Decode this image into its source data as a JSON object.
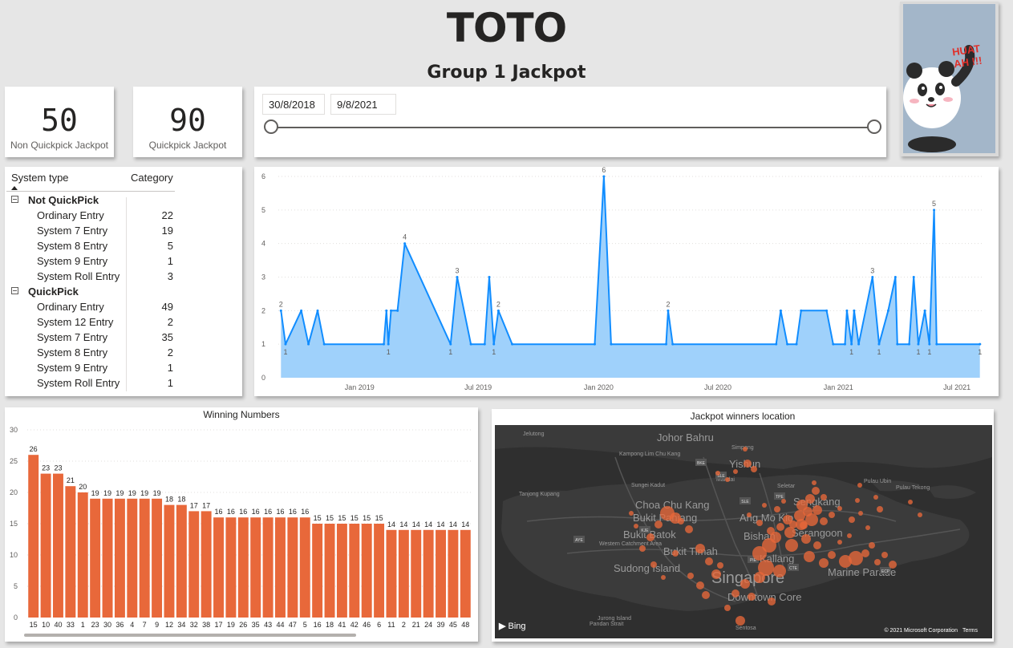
{
  "header": {
    "title": "TOTO",
    "subtitle": "Group 1 Jackpot"
  },
  "kpis": [
    {
      "value": "50",
      "label": "Non Quickpick Jackpot"
    },
    {
      "value": "90",
      "label": "Quickpick Jackpot"
    }
  ],
  "date_slicer": {
    "start": "30/8/2018",
    "end": "9/8/2021",
    "range_fraction": [
      0,
      1
    ]
  },
  "mascot": {
    "icon": "panda-icon",
    "caption": "HUAT AH !!!"
  },
  "matrix": {
    "col1": "System type",
    "col2": "Category",
    "groups": [
      {
        "name": "Not QuickPick",
        "rows": [
          {
            "label": "Ordinary Entry",
            "value": "22"
          },
          {
            "label": "System 7 Entry",
            "value": "19"
          },
          {
            "label": "System 8 Entry",
            "value": "5"
          },
          {
            "label": "System 9 Entry",
            "value": "1"
          },
          {
            "label": "System Roll Entry",
            "value": "3"
          }
        ]
      },
      {
        "name": "QuickPick",
        "rows": [
          {
            "label": "Ordinary Entry",
            "value": "49"
          },
          {
            "label": "System 12 Entry",
            "value": "2"
          },
          {
            "label": "System 7 Entry",
            "value": "35"
          },
          {
            "label": "System 8 Entry",
            "value": "2"
          },
          {
            "label": "System 9 Entry",
            "value": "1"
          },
          {
            "label": "System Roll Entry",
            "value": "1"
          }
        ]
      }
    ]
  },
  "chart_data": [
    {
      "type": "area",
      "title": "",
      "xlabel": "",
      "ylabel": "",
      "ylim": [
        0,
        6
      ],
      "yticks": [
        0,
        1,
        2,
        3,
        4,
        5,
        6
      ],
      "xticks": [
        {
          "date": "2019-01-01",
          "label": "Jan 2019"
        },
        {
          "date": "2019-07-01",
          "label": "Jul 2019"
        },
        {
          "date": "2020-01-01",
          "label": "Jan 2020"
        },
        {
          "date": "2020-07-01",
          "label": "Jul 2020"
        },
        {
          "date": "2021-01-01",
          "label": "Jan 2021"
        },
        {
          "date": "2021-07-01",
          "label": "Jul 2021"
        }
      ],
      "xlim": [
        "2018-08-30",
        "2021-08-09"
      ],
      "color": "#118dff",
      "fill": "#9fd1fb",
      "points": [
        {
          "x": "2018-09-03",
          "y": 2,
          "label": "2"
        },
        {
          "x": "2018-09-10",
          "y": 1,
          "label": "1"
        },
        {
          "x": "2018-10-04",
          "y": 2
        },
        {
          "x": "2018-10-15",
          "y": 1
        },
        {
          "x": "2018-10-29",
          "y": 2
        },
        {
          "x": "2018-11-08",
          "y": 1
        },
        {
          "x": "2019-02-07",
          "y": 1
        },
        {
          "x": "2019-02-11",
          "y": 2
        },
        {
          "x": "2019-02-14",
          "y": 1,
          "label": "1"
        },
        {
          "x": "2019-02-18",
          "y": 2
        },
        {
          "x": "2019-02-28",
          "y": 2
        },
        {
          "x": "2019-03-11",
          "y": 4,
          "label": "4"
        },
        {
          "x": "2019-05-20",
          "y": 1,
          "label": "1"
        },
        {
          "x": "2019-05-30",
          "y": 3,
          "label": "3"
        },
        {
          "x": "2019-06-20",
          "y": 1
        },
        {
          "x": "2019-07-11",
          "y": 1
        },
        {
          "x": "2019-07-18",
          "y": 3
        },
        {
          "x": "2019-07-25",
          "y": 1,
          "label": "1"
        },
        {
          "x": "2019-08-01",
          "y": 2,
          "label": "2"
        },
        {
          "x": "2019-08-22",
          "y": 1
        },
        {
          "x": "2019-12-26",
          "y": 1
        },
        {
          "x": "2020-01-09",
          "y": 6,
          "label": "6"
        },
        {
          "x": "2020-01-20",
          "y": 1
        },
        {
          "x": "2020-04-13",
          "y": 1
        },
        {
          "x": "2020-04-16",
          "y": 2,
          "label": "2"
        },
        {
          "x": "2020-04-23",
          "y": 1
        },
        {
          "x": "2020-09-28",
          "y": 1
        },
        {
          "x": "2020-10-05",
          "y": 2
        },
        {
          "x": "2020-10-15",
          "y": 1
        },
        {
          "x": "2020-10-29",
          "y": 1
        },
        {
          "x": "2020-11-05",
          "y": 2
        },
        {
          "x": "2020-12-14",
          "y": 2
        },
        {
          "x": "2020-12-24",
          "y": 1
        },
        {
          "x": "2021-01-11",
          "y": 1
        },
        {
          "x": "2021-01-14",
          "y": 2
        },
        {
          "x": "2021-01-21",
          "y": 1,
          "label": "1"
        },
        {
          "x": "2021-01-25",
          "y": 2
        },
        {
          "x": "2021-02-01",
          "y": 1
        },
        {
          "x": "2021-02-22",
          "y": 3,
          "label": "3"
        },
        {
          "x": "2021-03-04",
          "y": 1,
          "label": "1"
        },
        {
          "x": "2021-03-18",
          "y": 2
        },
        {
          "x": "2021-03-29",
          "y": 3
        },
        {
          "x": "2021-04-01",
          "y": 1
        },
        {
          "x": "2021-04-19",
          "y": 1
        },
        {
          "x": "2021-04-26",
          "y": 3
        },
        {
          "x": "2021-05-03",
          "y": 1,
          "label": "1"
        },
        {
          "x": "2021-05-13",
          "y": 2
        },
        {
          "x": "2021-05-20",
          "y": 1,
          "label": "1"
        },
        {
          "x": "2021-05-27",
          "y": 5,
          "label": "5"
        },
        {
          "x": "2021-05-31",
          "y": 1
        },
        {
          "x": "2021-08-05",
          "y": 1,
          "label": "1"
        }
      ]
    },
    {
      "type": "bar",
      "title": "Winning Numbers",
      "xlabel": "",
      "ylabel": "",
      "ylim": [
        0,
        30
      ],
      "yticks": [
        0,
        5,
        10,
        15,
        20,
        25,
        30
      ],
      "color": "#e8683a",
      "categories": [
        "15",
        "10",
        "40",
        "33",
        "1",
        "23",
        "30",
        "36",
        "4",
        "7",
        "9",
        "12",
        "34",
        "32",
        "38",
        "17",
        "19",
        "26",
        "35",
        "43",
        "44",
        "47",
        "5",
        "16",
        "18",
        "41",
        "42",
        "46",
        "6",
        "11",
        "2",
        "21",
        "24",
        "39",
        "45",
        "48"
      ],
      "values": [
        26,
        23,
        23,
        21,
        20,
        19,
        19,
        19,
        19,
        19,
        19,
        18,
        18,
        17,
        17,
        16,
        16,
        16,
        16,
        16,
        16,
        16,
        16,
        15,
        15,
        15,
        15,
        15,
        15,
        14,
        14,
        14,
        14,
        14,
        14,
        14
      ]
    }
  ],
  "map": {
    "title": "Jackpot winners location",
    "provider": "Bing",
    "copyright": "© 2021 Microsoft Corporation",
    "terms": "Terms",
    "marker_color": "#e8683a",
    "place_labels": [
      {
        "text": "Johor Bahru",
        "size": "md"
      },
      {
        "text": "Jelutong",
        "size": "sm"
      },
      {
        "text": "Kampong Lim Chu Kang",
        "size": "sm"
      },
      {
        "text": "Simpang",
        "size": "sm"
      },
      {
        "text": "Yishun",
        "size": "md"
      },
      {
        "text": "Mandai",
        "size": "sm"
      },
      {
        "text": "Sungei Kadut",
        "size": "sm"
      },
      {
        "text": "Seletar",
        "size": "sm"
      },
      {
        "text": "Pulau Ubin",
        "size": "sm"
      },
      {
        "text": "Pulau Tekong",
        "size": "sm"
      },
      {
        "text": "Tanjong Kupang",
        "size": "sm"
      },
      {
        "text": "Choa Chu Kang",
        "size": "md"
      },
      {
        "text": "Sengkang",
        "size": "md"
      },
      {
        "text": "Bukit Panjang",
        "size": "md"
      },
      {
        "text": "Ang Mo Kio",
        "size": "md"
      },
      {
        "text": "Western Catchment Area",
        "size": "sm"
      },
      {
        "text": "Bukit Batok",
        "size": "md"
      },
      {
        "text": "Bishan",
        "size": "md"
      },
      {
        "text": "Serangoon",
        "size": "md"
      },
      {
        "text": "Bukit Timah",
        "size": "md"
      },
      {
        "text": "Kallang",
        "size": "md"
      },
      {
        "text": "Sudong Island",
        "size": "md"
      },
      {
        "text": "Singapore",
        "size": "lg"
      },
      {
        "text": "Marine Parade",
        "size": "md"
      },
      {
        "text": "Downtown Core",
        "size": "md"
      },
      {
        "text": "Jurong Island",
        "size": "sm"
      },
      {
        "text": "Pandan Strait",
        "size": "sm"
      },
      {
        "text": "Sentosa",
        "size": "sm"
      }
    ],
    "road_badges": [
      "BKE",
      "SLE",
      "TPE",
      "SLE",
      "KJE",
      "PIE",
      "CTE",
      "AYE",
      "ECP"
    ]
  }
}
